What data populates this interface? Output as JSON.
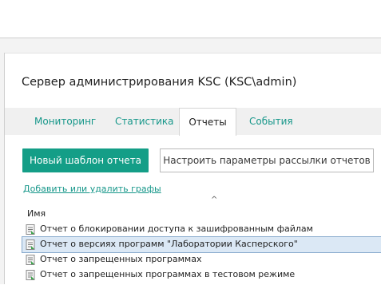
{
  "header": {
    "title": "Сервер администрирования KSC (KSC\\admin)"
  },
  "tabs": [
    {
      "label": "Мониторинг",
      "active": false
    },
    {
      "label": "Статистика",
      "active": false
    },
    {
      "label": "Отчеты",
      "active": true
    },
    {
      "label": "События",
      "active": false
    }
  ],
  "toolbar": {
    "new_template_label": "Новый шаблон отчета",
    "configure_delivery_label": "Настроить параметры рассылки отчетов"
  },
  "columns_link": "Добавить или удалить графы",
  "table": {
    "column_name": "Имя",
    "sort_indicator": "^",
    "rows": [
      {
        "name": "Отчет о блокировании доступа к зашифрованным файлам",
        "selected": false
      },
      {
        "name": "Отчет о версиях программ \"Лаборатории Касперского\"",
        "selected": true
      },
      {
        "name": "Отчет о запрещенных программах",
        "selected": false
      },
      {
        "name": "Отчет о запрещенных программах в тестовом режиме",
        "selected": false
      }
    ]
  },
  "colors": {
    "accent": "#149e87",
    "link": "#17978a",
    "selection": "#dbe8f5"
  },
  "icons": {
    "row_icon": "report-document-icon"
  }
}
